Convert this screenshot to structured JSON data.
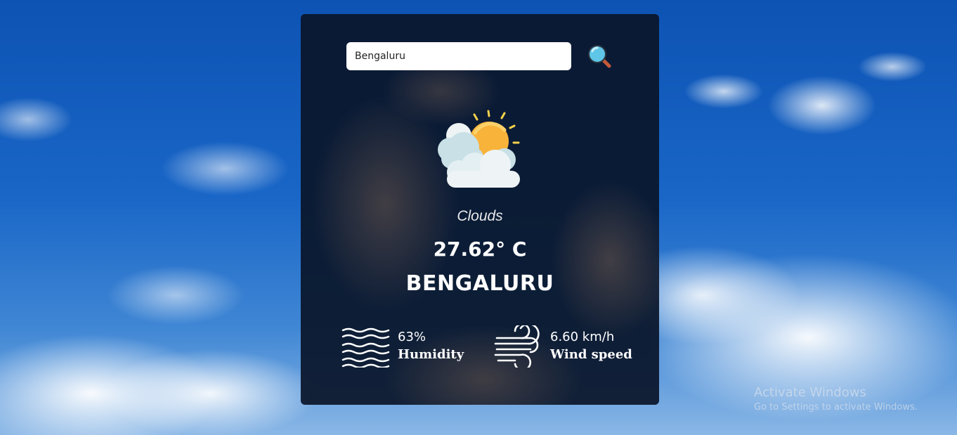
{
  "search": {
    "value": "Bengaluru",
    "button_icon": "magnifier-icon"
  },
  "weather": {
    "icon": "sun-behind-clouds-icon",
    "description": "Clouds",
    "temperature": "27.62° C",
    "city": "BENGALURU"
  },
  "humidity": {
    "icon": "waves-icon",
    "value": "63%",
    "label": "Humidity"
  },
  "wind": {
    "icon": "wind-icon",
    "value": "6.60 km/h",
    "label": "Wind speed"
  },
  "watermark": {
    "title": "Activate Windows",
    "subtitle": "Go to Settings to activate Windows."
  },
  "colors": {
    "card_background": "#0a162a",
    "sun": "#f8b33a",
    "cloud": "#d4e8ee"
  }
}
